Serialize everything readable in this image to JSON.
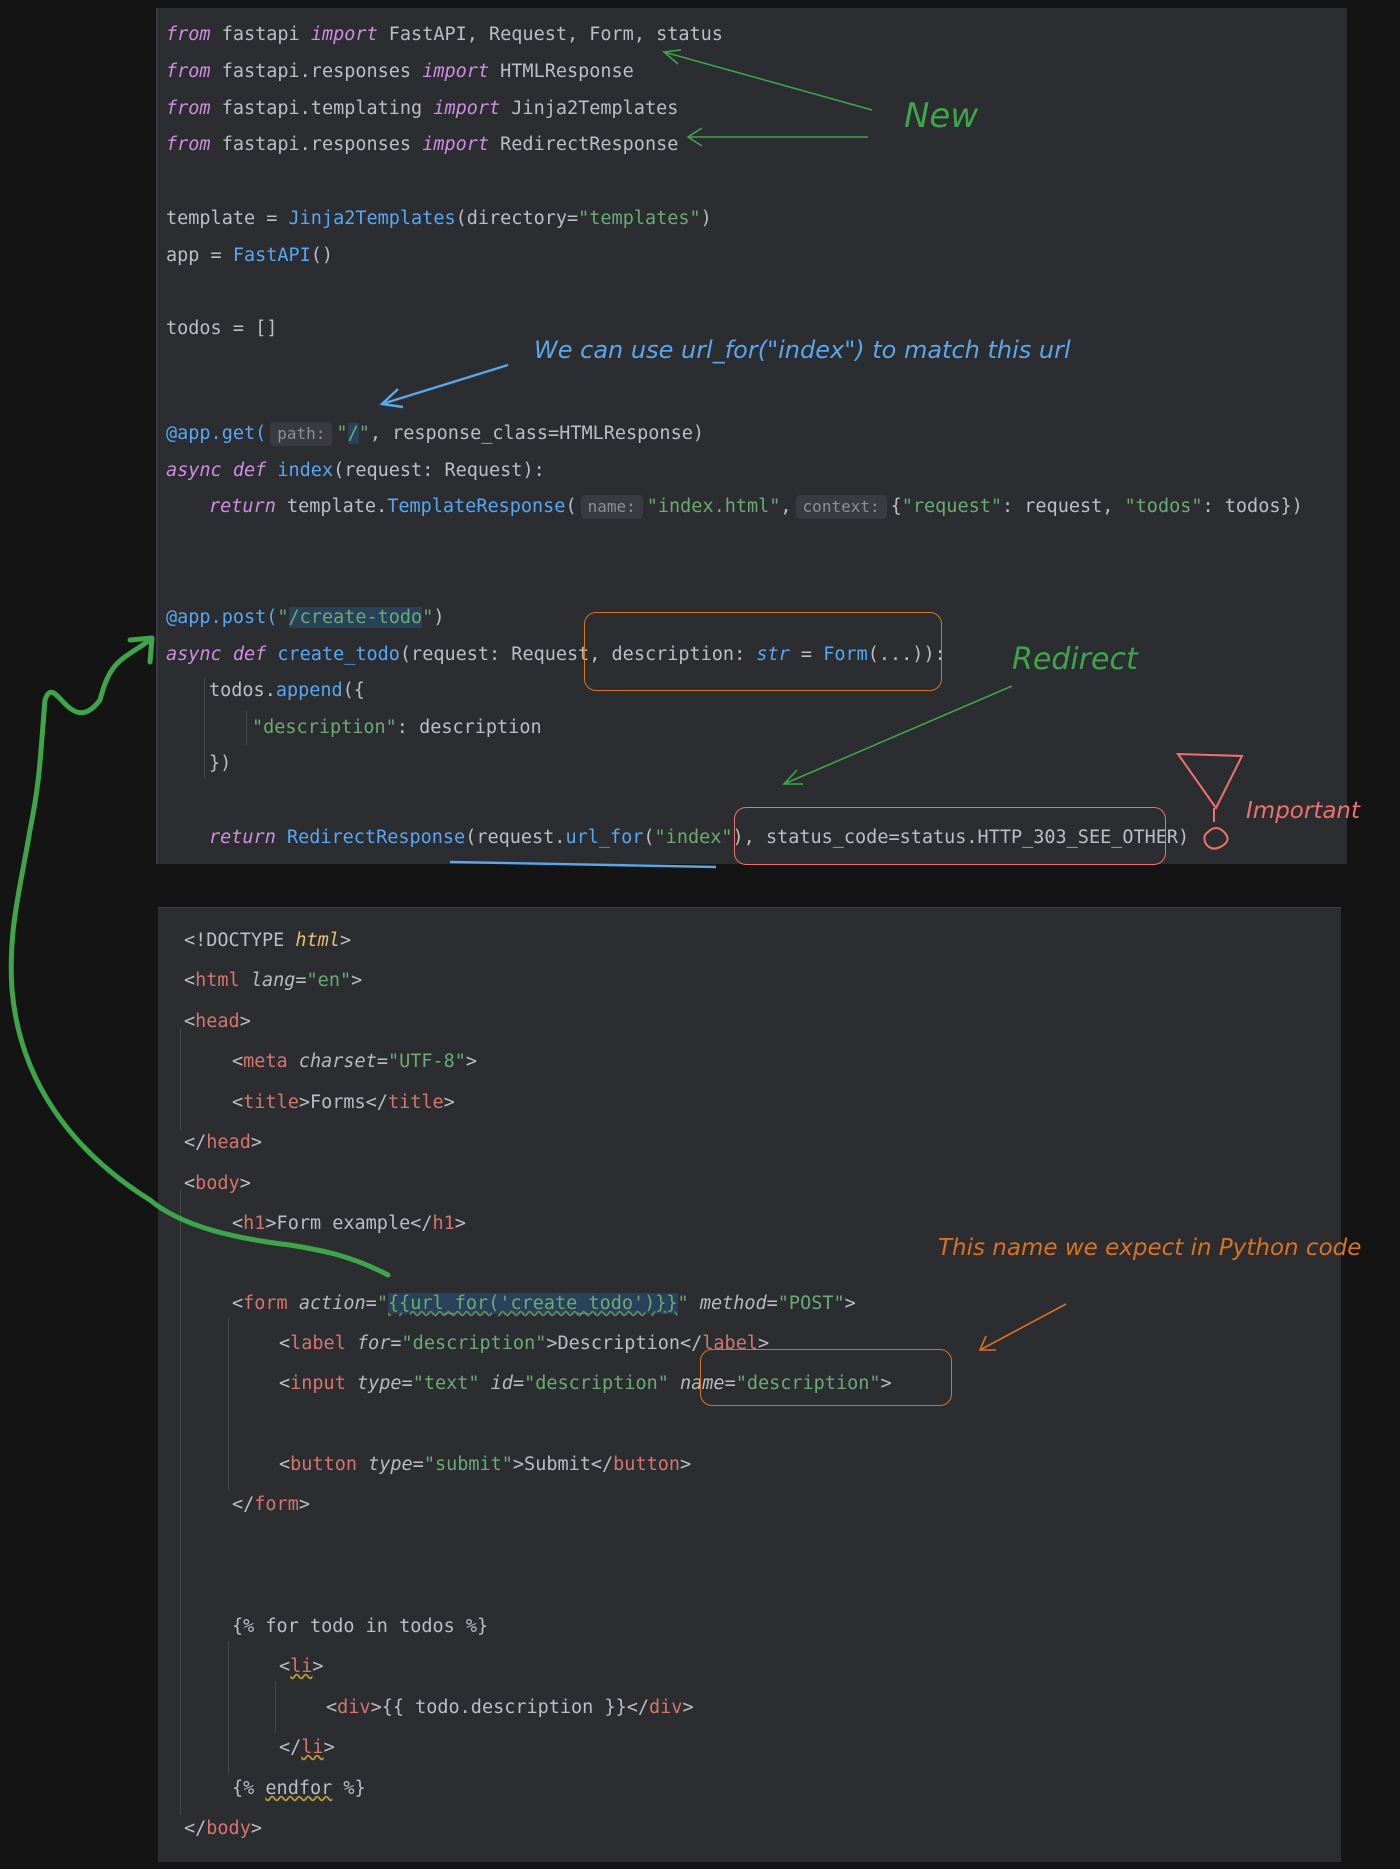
{
  "python": {
    "l1": {
      "kw1": "from",
      "mod": " fastapi ",
      "kw2": "import",
      "rest": " FastAPI, Request, Form, status"
    },
    "l2": {
      "kw1": "from",
      "mod": " fastapi.responses ",
      "kw2": "import",
      "rest": " HTMLResponse"
    },
    "l3": {
      "kw1": "from",
      "mod": " fastapi.templating ",
      "kw2": "import",
      "rest": " Jinja2Templates"
    },
    "l4": {
      "kw1": "from",
      "mod": " fastapi.responses ",
      "kw2": "import",
      "rest": " RedirectResponse"
    },
    "l5": {
      "a": "template = ",
      "fn": "Jinja2Templates",
      "b": "(directory=",
      "s": "\"templates\"",
      "c": ")"
    },
    "l6": {
      "a": "app = ",
      "fn": "FastAPI",
      "b": "()"
    },
    "l7": {
      "a": "todos = []"
    },
    "l8": {
      "dec": "@app.get(",
      "hint": "path:",
      "s1": "\"",
      "sel": "/",
      "s2": "\"",
      "rest": ", response_class=HTMLResponse)"
    },
    "l9": {
      "kw": "async def ",
      "fn": "index",
      "rest": "(request: Request):"
    },
    "l10": {
      "kw": "return",
      "a": " template.",
      "fn": "TemplateResponse",
      "b": "(",
      "hint1": "name:",
      "s1": "\"index.html\"",
      "c": ",",
      "hint2": "context:",
      "d": "{",
      "s2": "\"request\"",
      "e": ": request, ",
      "s3": "\"todos\"",
      "f": ": todos})"
    },
    "l11": {
      "dec": "@app.post(",
      "s1": "\"",
      "sel": "/create-todo",
      "s2": "\"",
      "c": ")"
    },
    "l12": {
      "kw": "async def ",
      "fn": "create_todo",
      "a": "(request: Request, ",
      "b": "description: ",
      "typ": "str",
      "c": " = ",
      "fn2": "Form",
      "d": "(...)):"
    },
    "l13": {
      "a": "todos.",
      "fn": "append",
      "b": "({"
    },
    "l14": {
      "s": "\"description\"",
      "a": ": description"
    },
    "l15": {
      "a": "})"
    },
    "l16": {
      "kw": "return",
      "sp": " ",
      "fn": "RedirectResponse",
      "a": "(request.",
      "fn2": "url_for",
      "b": "(",
      "s": "\"index\"",
      "c": "), ",
      "d": "status_code=status.HTTP_303_SEE_OTHER)"
    }
  },
  "html": {
    "l1": {
      "a": "<!DOCTYPE ",
      "b": "html",
      "c": ">"
    },
    "l2": {
      "a": "<",
      "t": "html",
      "sp": " ",
      "at": "lang",
      "eq": "=",
      "v": "\"en\"",
      "c": ">"
    },
    "l3": {
      "a": "<",
      "t": "head",
      "c": ">"
    },
    "l4": {
      "a": "<",
      "t": "meta",
      "sp": " ",
      "at": "charset",
      "eq": "=",
      "v": "\"UTF-8\"",
      "c": ">"
    },
    "l5": {
      "a": "<",
      "t": "title",
      "b": ">Forms</",
      "t2": "title",
      "c": ">"
    },
    "l6": {
      "a": "</",
      "t": "head",
      "c": ">"
    },
    "l7": {
      "a": "<",
      "t": "body",
      "c": ">"
    },
    "l8": {
      "a": "<",
      "t": "h1",
      "b": ">Form example</",
      "t2": "h1",
      "c": ">"
    },
    "l9": {
      "a": "<",
      "t": "form",
      "sp": " ",
      "at": "action",
      "eq": "=",
      "q1": "\"",
      "sel": "{{url_for('create_todo')}}",
      "q2": "\"",
      "sp2": " ",
      "at2": "method",
      "eq2": "=",
      "v2": "\"POST\"",
      "c": ">"
    },
    "l10": {
      "a": "<",
      "t": "label",
      "sp": " ",
      "at": "for",
      "eq": "=",
      "v": "\"description\"",
      "b": ">Description</",
      "t2": "label",
      "c": ">"
    },
    "l11": {
      "a": "<",
      "t": "input",
      "sp": " ",
      "at": "type",
      "eq": "=",
      "v": "\"text\"",
      "sp2": " ",
      "at2": "id",
      "eq2": "=",
      "v2": "\"description\"",
      "sp3": " ",
      "at3": "name",
      "eq3": "=",
      "v3": "\"description\"",
      "c": ">"
    },
    "l12": {
      "a": "<",
      "t": "button",
      "sp": " ",
      "at": "type",
      "eq": "=",
      "v": "\"submit\"",
      "b": ">Submit</",
      "t2": "button",
      "c": ">"
    },
    "l13": {
      "a": "</",
      "t": "form",
      "c": ">"
    },
    "l14": {
      "a": "{% for todo in todos %}"
    },
    "l15": {
      "a": "<",
      "t": "li",
      "c": ">"
    },
    "l16": {
      "a": "<",
      "t": "div",
      "b": ">{{ todo.description }}</",
      "t2": "div",
      "c": ">"
    },
    "l17": {
      "a": "</",
      "t": "li",
      "c": ">"
    },
    "l18": {
      "a": "{% ",
      "b": "endfor",
      "c": " %}"
    },
    "l19": {
      "a": "</",
      "t": "body",
      "c": ">"
    }
  },
  "annotations": {
    "new": "New",
    "url_for": "We can use url_for(\"index\") to match this url",
    "redirect": "Redirect",
    "important": "Important",
    "python_name": "This name we expect in Python code"
  },
  "colors": {
    "green": "#3fa54a",
    "blue": "#5aa7ea",
    "orange": "#d9731f",
    "pink": "#f07070"
  }
}
